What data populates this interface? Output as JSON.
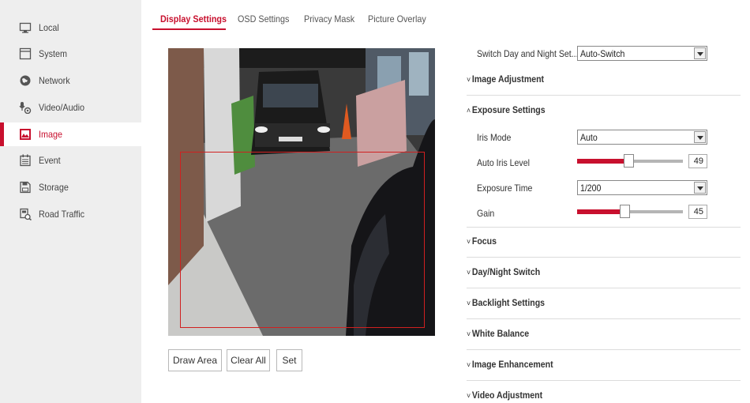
{
  "sidebar": {
    "items": [
      {
        "label": "Local",
        "icon": "monitor-icon"
      },
      {
        "label": "System",
        "icon": "system-icon"
      },
      {
        "label": "Network",
        "icon": "globe-icon"
      },
      {
        "label": "Video/Audio",
        "icon": "mic-camera-icon"
      },
      {
        "label": "Image",
        "icon": "image-icon"
      },
      {
        "label": "Event",
        "icon": "calendar-icon"
      },
      {
        "label": "Storage",
        "icon": "storage-icon"
      },
      {
        "label": "Road Traffic",
        "icon": "road-traffic-icon"
      }
    ],
    "active": "Image"
  },
  "tabs": [
    {
      "label": "Display Settings",
      "active": true
    },
    {
      "label": "OSD Settings",
      "active": false
    },
    {
      "label": "Privacy Mask",
      "active": false
    },
    {
      "label": "Picture Overlay",
      "active": false
    }
  ],
  "video_buttons": {
    "draw_area": "Draw Area",
    "clear_all": "Clear All",
    "set": "Set"
  },
  "settings": {
    "day_night_set": {
      "label": "Switch Day and Night Set...",
      "value": "Auto-Switch"
    },
    "exposure": {
      "iris_mode": {
        "label": "Iris Mode",
        "value": "Auto"
      },
      "auto_iris_level": {
        "label": "Auto Iris Level",
        "value": 49
      },
      "exposure_time": {
        "label": "Exposure Time",
        "value": "1/200"
      },
      "gain": {
        "label": "Gain",
        "value": 45
      }
    },
    "sections": [
      {
        "label": "Image Adjustment",
        "expanded": false
      },
      {
        "label": "Exposure Settings",
        "expanded": true
      },
      {
        "label": "Focus",
        "expanded": false
      },
      {
        "label": "Day/Night Switch",
        "expanded": false
      },
      {
        "label": "Backlight Settings",
        "expanded": false
      },
      {
        "label": "White Balance",
        "expanded": false
      },
      {
        "label": "Image Enhancement",
        "expanded": false
      },
      {
        "label": "Video Adjustment",
        "expanded": false
      }
    ]
  },
  "glyphs": {
    "collapsed": "˅",
    "expanded": "˄"
  },
  "colors": {
    "accent": "#c8102e",
    "sidebar_bg": "#eeeeee",
    "roi_border": "#d02020"
  }
}
